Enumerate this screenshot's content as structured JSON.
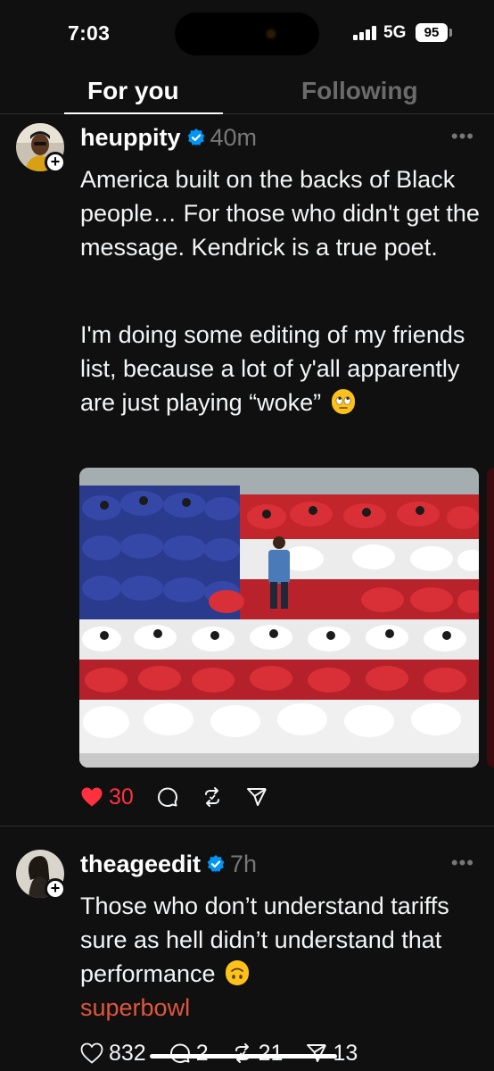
{
  "status_bar": {
    "time": "7:03",
    "network": "5G",
    "battery": "95"
  },
  "tabs": [
    {
      "label": "For you",
      "active": true
    },
    {
      "label": "Following",
      "active": false
    }
  ],
  "posts": [
    {
      "handle": "heuppity",
      "verified": true,
      "time_ago": "40m",
      "paragraphs": [
        "America built on the backs of Black people… For those who didn't get the message. Kendrick is a true poet.",
        "I'm doing some editing of my friends list, because a lot of y'all apparently are just playing “woke”"
      ],
      "emoji": "eye-roll-emoji",
      "likes": "30",
      "liked": true
    },
    {
      "handle": "theageedit",
      "verified": true,
      "time_ago": "7h",
      "text": "Those who don’t understand tariffs sure as hell didn’t understand that performance",
      "emoji": "upside-down-face-emoji",
      "tag": "superbowl",
      "likes": "832",
      "comments": "2",
      "reposts": "21",
      "shares": "13"
    }
  ],
  "colors": {
    "background": "#101010",
    "accent_like": "#ff3040",
    "tag": "#e0563d",
    "verified": "#0095f6"
  },
  "icons": [
    "heart-icon",
    "comment-icon",
    "repost-icon",
    "share-icon",
    "verified-icon",
    "more-icon",
    "follow-plus-icon"
  ]
}
